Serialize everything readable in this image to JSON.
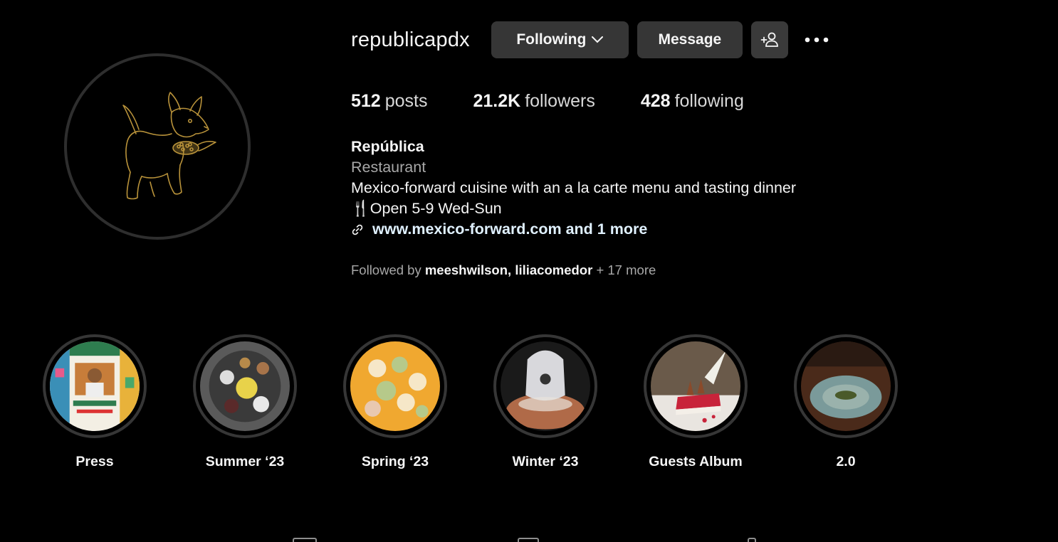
{
  "profile": {
    "username": "republicapdx",
    "following_label": "Following",
    "message_label": "Message",
    "avatar_icon": "dog-with-corn-logo"
  },
  "stats": {
    "posts_count": "512",
    "posts_label": "posts",
    "followers_count": "21.2K",
    "followers_label": "followers",
    "following_count": "428",
    "following_label": "following"
  },
  "bio": {
    "name": "República",
    "category": "Restaurant",
    "description": "Mexico-forward cuisine with an a la carte menu and tasting dinner",
    "hours": "🍴Open 5-9 Wed-Sun",
    "link": "www.mexico-forward.com and 1 more"
  },
  "followed_by": {
    "prefix": "Followed by",
    "user1": "meeshwilson,",
    "user2": "liliacomedor",
    "suffix": "+ 17 more"
  },
  "highlights": [
    {
      "label": "Press"
    },
    {
      "label": "Summer ‘23"
    },
    {
      "label": "Spring ‘23"
    },
    {
      "label": "Winter ‘23"
    },
    {
      "label": "Guests Album"
    },
    {
      "label": "2.0"
    }
  ],
  "colors": {
    "background": "#000000",
    "button": "#363636",
    "muted": "#a8a8a8",
    "link": "#e0f1ff",
    "logo_gold": "#b8923a"
  }
}
